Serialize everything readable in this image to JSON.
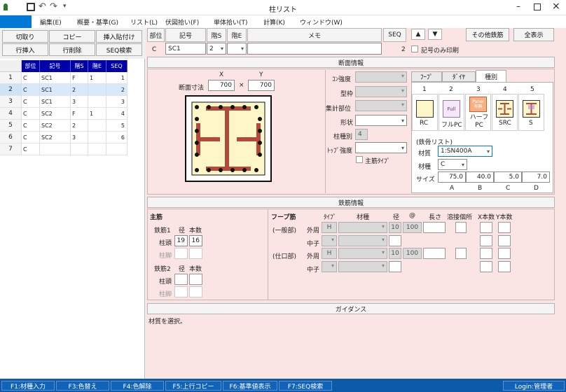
{
  "window": {
    "title": "柱リスト"
  },
  "menu": [
    "編集(E)",
    "概要・基準(G)",
    "リスト(L)",
    "伏図拾い(F)",
    "単体拾い(T)",
    "計算(K)",
    "ウィンドウ(W)"
  ],
  "left_buttons": {
    "cut": "切取り",
    "copy": "コピー",
    "paste_insert": "挿入貼付け",
    "row_insert": "行挿入",
    "row_delete": "行削除",
    "seq_search": "SEQ検索"
  },
  "grid": {
    "headers": [
      "部位",
      "記号",
      "階S",
      "階E",
      "SEQ"
    ],
    "rows": [
      {
        "n": "1",
        "buii": "C",
        "kigou": "SC1",
        "kaiS": "F",
        "kaiE": "1",
        "seq": "1"
      },
      {
        "n": "2",
        "buii": "C",
        "kigou": "SC1",
        "kaiS": "2",
        "kaiE": "",
        "seq": "2"
      },
      {
        "n": "3",
        "buii": "C",
        "kigou": "SC1",
        "kaiS": "3",
        "kaiE": "",
        "seq": "3"
      },
      {
        "n": "4",
        "buii": "C",
        "kigou": "SC2",
        "kaiS": "F",
        "kaiE": "1",
        "seq": "4"
      },
      {
        "n": "5",
        "buii": "C",
        "kigou": "SC2",
        "kaiS": "2",
        "kaiE": "",
        "seq": "5"
      },
      {
        "n": "6",
        "buii": "C",
        "kigou": "SC2",
        "kaiS": "3",
        "kaiE": "",
        "seq": "6"
      },
      {
        "n": "7",
        "buii": "C",
        "kigou": "",
        "kaiS": "",
        "kaiE": "",
        "seq": ""
      }
    ]
  },
  "record": {
    "headers": {
      "buii": "部位",
      "kigou": "記号",
      "kaiS": "階S",
      "kaiE": "階E",
      "memo": "メモ",
      "seq": "SEQ"
    },
    "buii": "C",
    "kigou": "SC1",
    "kaiS": "2",
    "kaiE": "",
    "memo": "",
    "seq": "2",
    "only_print_label": "記号のみ印刷",
    "other_rebar": "その他鉄筋",
    "show_all": "全表示",
    "up_arrow": "▲",
    "down_arrow": "▼"
  },
  "section": {
    "title": "断面情報",
    "x_label": "X",
    "y_label": "Y",
    "dim_label": "断面寸法",
    "x_value": "700",
    "y_value": "700",
    "times": "×",
    "concrete_strength": "ｺﾝ強度",
    "formwork": "型枠",
    "tally_part": "集計部位",
    "shape": "形状",
    "column_type": "柱種別",
    "column_type_value": "4",
    "top_strength": "ﾄｯﾌﾟ強度",
    "main_rebar_type": "主筋ﾀｲﾌﾟ",
    "tabs": [
      "ﾌｰﾌﾟ",
      "ﾀﾞｲﾔ",
      "種別"
    ],
    "types": [
      {
        "num": "1",
        "label": "RC"
      },
      {
        "num": "2",
        "label": "フルPC",
        "icon_text": "Full"
      },
      {
        "num": "3",
        "label": "ハーフPC",
        "icon_text": "Panel 有無"
      },
      {
        "num": "4",
        "label": "SRC"
      },
      {
        "num": "5",
        "label": "S"
      }
    ],
    "steel_list_label": "(鉄骨リスト)",
    "material_label": "材質",
    "material_value": "1:SN400A",
    "kind_label": "材種",
    "kind_value": "C",
    "size_label": "サイズ",
    "sizes": [
      "75.0",
      "40.0",
      "5.0",
      "7.0"
    ],
    "size_letters": [
      "A",
      "B",
      "C",
      "D"
    ]
  },
  "rebar": {
    "title": "鉄筋情報",
    "main": "主筋",
    "rebar1": "鉄筋1",
    "diameter": "径",
    "count": "本数",
    "head": "柱頭",
    "foot": "柱脚",
    "rebar1_head_d": "19",
    "rebar1_head_n": "16",
    "rebar2": "鉄筋2",
    "hoop": "フープ筋",
    "type_col": "ﾀｲﾌﾟ",
    "material_col": "材種",
    "dia_col": "径",
    "pitch_col": "@",
    "length_col": "長さ",
    "weld_col": "溶接個所",
    "xcount_col": "X本数",
    "ycount_col": "Y本数",
    "general": "(一般部)",
    "joint": "(仕口部)",
    "outer": "外周",
    "middle": "中子",
    "h": "H",
    "gen_dia": "10",
    "gen_pitch": "100",
    "joint_dia": "10",
    "joint_pitch": "100"
  },
  "guidance": {
    "title": "ガイダンス",
    "text": "材質を選択。"
  },
  "status": [
    "F1:材種入力",
    "F3:色替え",
    "F4:色解除",
    "F5:上行コピー",
    "F6:基準値表示",
    "F7:SEQ検索"
  ],
  "login": "Login:管理者",
  "colors": {
    "accent": "#0078d7",
    "pink": "#fbe4e4",
    "grid_header": "#0000a8",
    "status": "#0d5aa8",
    "rebar": "#b04a3a"
  }
}
